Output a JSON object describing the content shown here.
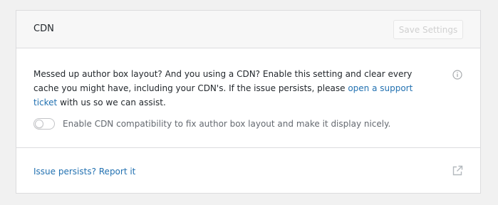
{
  "card": {
    "title": "CDN",
    "save_label": "Save Settings"
  },
  "body": {
    "description_before": "Messed up author box layout? And you using a CDN? Enable this setting and clear every cache you might have, including your CDN's. If the issue persists, please ",
    "support_link": "open a support ticket",
    "description_after": " with us so we can assist.",
    "toggle_label": "Enable CDN compatibility to fix author box layout and make it display nicely.",
    "toggle_enabled": false
  },
  "footer": {
    "report_link": "Issue persists? Report it"
  },
  "icons": {
    "info": "info-icon",
    "external": "external-link-icon"
  },
  "colors": {
    "link": "#2271b1",
    "border": "#dcdcde",
    "header_bg": "#f7f7f7"
  }
}
